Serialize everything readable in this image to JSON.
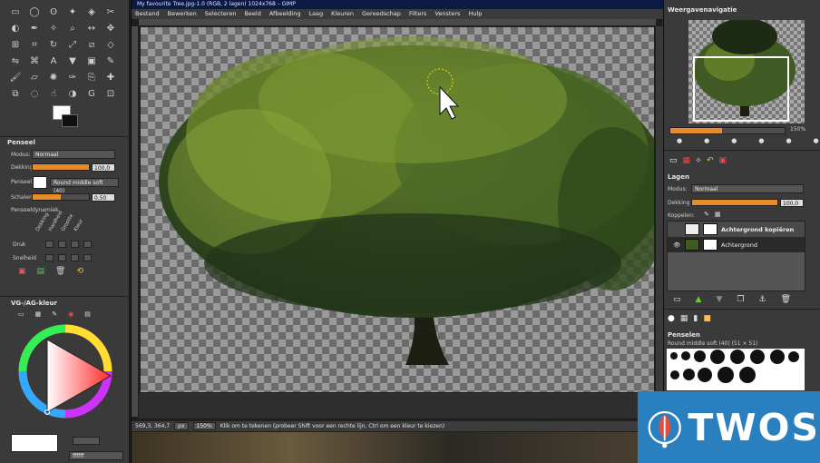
{
  "window": {
    "title": "My favourite Tree.jpg-1.0 (RGB, 2 lagen) 1024x768 – GIMP"
  },
  "menu": [
    "Bestand",
    "Bewerken",
    "Selecteren",
    "Beeld",
    "Afbeelding",
    "Laag",
    "Kleuren",
    "Gereedschap",
    "Filters",
    "Vensters",
    "Hulp"
  ],
  "toolbox": {
    "tools": [
      "rect-select-icon",
      "ellipse-select-icon",
      "lasso-icon",
      "fuzzy-select-icon",
      "color-select-icon",
      "scissors-icon",
      "foreground-select-icon",
      "paths-icon",
      "color-picker-icon",
      "zoom-icon",
      "measure-icon",
      "move-icon",
      "align-icon",
      "crop-icon",
      "rotate-icon",
      "scale-icon",
      "shear-icon",
      "perspective-icon",
      "flip-icon",
      "cage-icon",
      "text-icon",
      "bucket-fill-icon",
      "blend-icon",
      "pencil-icon",
      "paintbrush-icon",
      "eraser-icon",
      "airbrush-icon",
      "ink-icon",
      "clone-icon",
      "heal-icon",
      "perspective-clone-icon",
      "blur-icon",
      "smudge-icon",
      "dodge-burn-icon",
      "gegl-icon",
      "unified-transform-icon"
    ],
    "fg_color": "#ffffff",
    "bg_color": "#111111"
  },
  "tool_options": {
    "title": "Penseel",
    "mode_label": "Modus:",
    "mode_value": "Normaal",
    "opacity_label": "Dekking",
    "opacity_value": "100,0",
    "opacity_fraction": 1.0,
    "brush_label": "Penseel",
    "brush_value": "Round middle soft (40)",
    "scale_label": "Schalen",
    "scale_value": "0,50",
    "dynamics_label": "Penseeldynamiek",
    "dynamics_columns": [
      "Dekking",
      "Hardheid",
      "Grootte",
      "Kleur"
    ],
    "pressure_label": "Druk",
    "speed_label": "Snelheid"
  },
  "fgbg_panel": {
    "title": "VG-/AG-kleur",
    "hex_value": "ffffff"
  },
  "status": {
    "coords": "569,3, 364,7",
    "unit": "px",
    "zoom": "150%",
    "message": "Klik om te tekenen (probeer Shift voor een rechte lijn, Ctrl om een kleur te kiezen)"
  },
  "navigation": {
    "title": "Weergavenavigatie",
    "zoom_value": "150%"
  },
  "layers": {
    "title": "Lagen",
    "mode_label": "Modus:",
    "mode_value": "Normaal",
    "opacity_label": "Dekking",
    "opacity_value": "100,0",
    "lock_label": "Koppelen:",
    "items": [
      {
        "name": "Achtergrond kopiëren",
        "visible": false
      },
      {
        "name": "Achtergrond",
        "visible": true
      }
    ]
  },
  "brushes": {
    "title": "Penselen",
    "current": "Round middle soft (40) (51 × 51)"
  },
  "logo": {
    "text": "TWOS",
    "color": "#2a7fbe"
  }
}
